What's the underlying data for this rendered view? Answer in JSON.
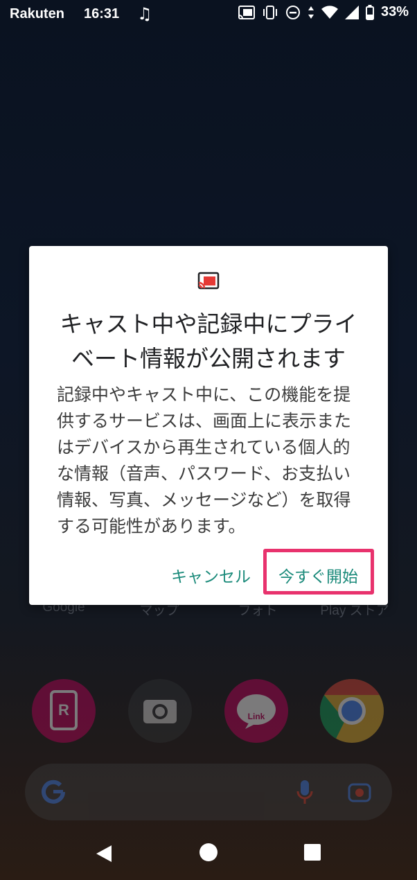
{
  "status_bar": {
    "carrier": "Rakuten",
    "time": "16:31",
    "music_icon": "music-note-icon",
    "icons": [
      "cast-icon",
      "vibrate-icon",
      "do-not-disturb-icon",
      "wifi-icon",
      "signal-icon",
      "battery-icon"
    ],
    "battery_percent": "33%"
  },
  "home_screen": {
    "dock_labels": [
      "Google",
      "マップ",
      "フォト",
      "Play ストア"
    ],
    "apps": [
      {
        "icon": "rakuten-app-icon",
        "color": "#c0005a"
      },
      {
        "icon": "camera-app-icon",
        "color": "#2f3234"
      },
      {
        "icon": "rakuten-link-app-icon",
        "color": "#c0005a"
      },
      {
        "icon": "chrome-app-icon",
        "color": "#e0b030"
      }
    ],
    "search_bar": {
      "left_icon": "google-g-icon",
      "mic_icon": "microphone-icon",
      "lens_icon": "lens-icon"
    }
  },
  "dialog": {
    "icon": "cast-icon",
    "title": "キャスト中や記録中にプライベート情報が公開されます",
    "body": "記録中やキャスト中に、この機能を提供するサービスは、画面上に表示またはデバイスから再生されている個人的な情報（音声、パスワード、お支払い情報、写真、メッセージなど）を取得する可能性があります。",
    "cancel_label": "キャンセル",
    "start_label": "今すぐ開始",
    "accent_color": "#1a8a7a",
    "highlight_color": "#e8326d"
  },
  "nav_bar": {
    "back": "back-icon",
    "home": "home-icon",
    "recents": "recents-icon"
  }
}
